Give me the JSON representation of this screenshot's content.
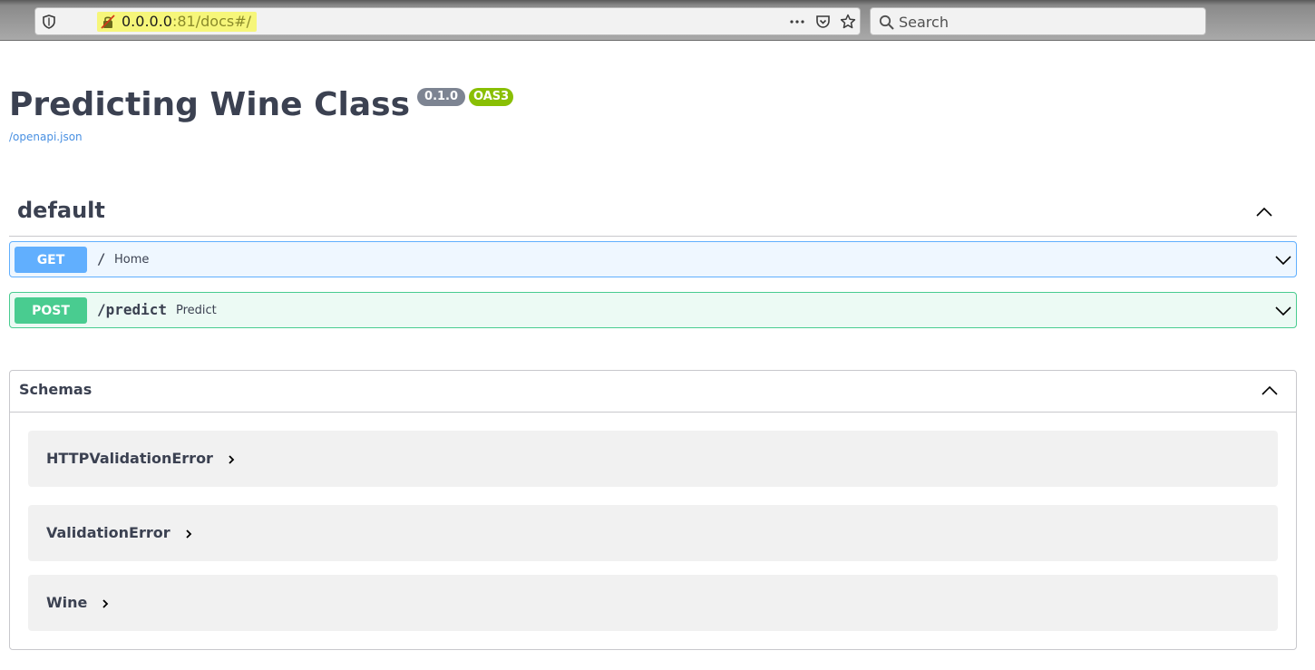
{
  "browser": {
    "url_host": "0.0.0.0",
    "url_rest": ":81/docs#/",
    "search_placeholder": "Search",
    "menu_icon": "ellipsis-icon",
    "pocket_icon": "pocket-icon",
    "bookmark_icon": "star-icon"
  },
  "page": {
    "title": "Predicting Wine Class",
    "version_badge": "0.1.0",
    "oas_badge": "OAS3",
    "openapi_link": "/openapi.json"
  },
  "tag": {
    "name": "default"
  },
  "operations": [
    {
      "method": "GET",
      "path": "/",
      "summary": "Home",
      "color": "#61affe"
    },
    {
      "method": "POST",
      "path": "/predict",
      "summary": "Predict",
      "color": "#49cc90"
    }
  ],
  "schemas": {
    "title": "Schemas",
    "models": [
      {
        "name": "HTTPValidationError"
      },
      {
        "name": "ValidationError"
      },
      {
        "name": "Wine"
      }
    ]
  },
  "colors": {
    "text": "#3b4151",
    "link": "#4990e2",
    "badge_version": "#7d8492",
    "badge_oas": "#89bf04"
  }
}
